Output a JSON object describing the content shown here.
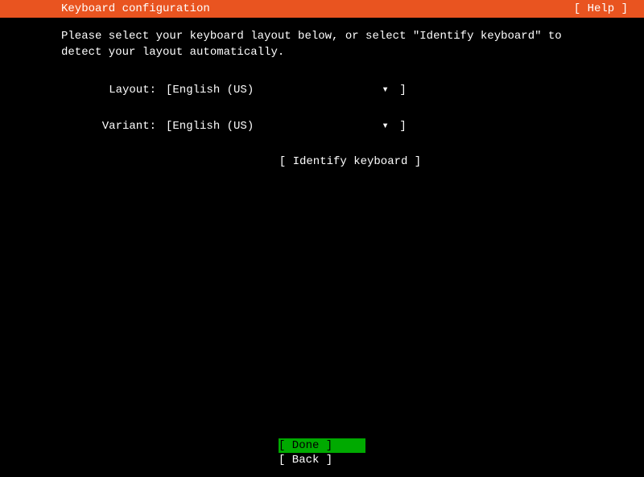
{
  "header": {
    "title": "Keyboard configuration",
    "help": "[ Help ]"
  },
  "description": "Please select your keyboard layout below, or select \"Identify keyboard\" to detect your layout automatically.",
  "form": {
    "layout": {
      "label": "Layout:",
      "open": "[ ",
      "value": "English (US)",
      "arrow": "▾",
      "close": " ]"
    },
    "variant": {
      "label": "Variant:",
      "open": "[ ",
      "value": "English (US)",
      "arrow": "▾",
      "close": " ]"
    }
  },
  "identify": {
    "label": "[ Identify keyboard ]"
  },
  "footer": {
    "done": "[ Done       ]",
    "back": "[ Back       ]"
  }
}
